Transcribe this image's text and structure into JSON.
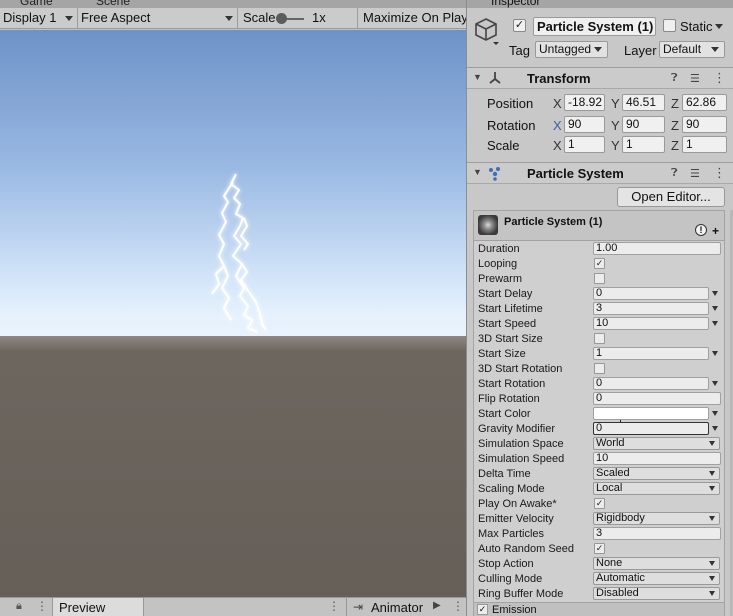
{
  "tabs": {
    "game": "Game",
    "scene": "Scene",
    "inspector": "Inspector"
  },
  "game_toolbar": {
    "display": "Display 1",
    "aspect": "Free Aspect",
    "scale_label": "Scale",
    "scale_value": "1x",
    "maximize": "Maximize On Play"
  },
  "bottom_bar": {
    "preview": "Preview",
    "animator": "Animator"
  },
  "object": {
    "name": "Particle System (1)",
    "static_label": "Static",
    "tag_label": "Tag",
    "tag_value": "Untagged",
    "layer_label": "Layer",
    "layer_value": "Default"
  },
  "transform": {
    "title": "Transform",
    "position_label": "Position",
    "rotation_label": "Rotation",
    "scale_label": "Scale",
    "axis_x": "X",
    "axis_y": "Y",
    "axis_z": "Z",
    "position": {
      "x": "-18.92",
      "y": "46.51",
      "z": "62.86"
    },
    "rotation": {
      "x": "90",
      "y": "90",
      "z": "90"
    },
    "scale": {
      "x": "1",
      "y": "1",
      "z": "1"
    }
  },
  "particle_system": {
    "title": "Particle System",
    "open_editor": "Open Editor...",
    "module_title": "Particle System (1)",
    "rows": [
      {
        "label": "Duration",
        "kind": "field",
        "value": "1.00"
      },
      {
        "label": "Looping",
        "kind": "check",
        "checked": true
      },
      {
        "label": "Prewarm",
        "kind": "check",
        "checked": false
      },
      {
        "label": "Start Delay",
        "kind": "field-arrow",
        "value": "0"
      },
      {
        "label": "Start Lifetime",
        "kind": "field-arrow",
        "value": "3"
      },
      {
        "label": "Start Speed",
        "kind": "field-arrow",
        "value": "10"
      },
      {
        "label": "3D Start Size",
        "kind": "check",
        "checked": false
      },
      {
        "label": "Start Size",
        "kind": "field-arrow",
        "value": "1"
      },
      {
        "label": "3D Start Rotation",
        "kind": "check",
        "checked": false
      },
      {
        "label": "Start Rotation",
        "kind": "field-arrow",
        "value": "0"
      },
      {
        "label": "Flip Rotation",
        "kind": "field",
        "value": "0"
      },
      {
        "label": "Start Color",
        "kind": "color-arrow",
        "value": "#ffffff"
      },
      {
        "label": "Gravity Modifier",
        "kind": "field-arrow-active",
        "value": "0"
      },
      {
        "label": "Simulation Space",
        "kind": "dropdown",
        "value": "World"
      },
      {
        "label": "Simulation Speed",
        "kind": "field",
        "value": "10"
      },
      {
        "label": "Delta Time",
        "kind": "dropdown",
        "value": "Scaled"
      },
      {
        "label": "Scaling Mode",
        "kind": "dropdown",
        "value": "Local"
      },
      {
        "label": "Play On Awake*",
        "kind": "check",
        "checked": true
      },
      {
        "label": "Emitter Velocity",
        "kind": "dropdown",
        "value": "Rigidbody"
      },
      {
        "label": "Max Particles",
        "kind": "field",
        "value": "3"
      },
      {
        "label": "Auto Random Seed",
        "kind": "check",
        "checked": true
      },
      {
        "label": "Stop Action",
        "kind": "dropdown",
        "value": "None"
      },
      {
        "label": "Culling Mode",
        "kind": "dropdown",
        "value": "Automatic"
      },
      {
        "label": "Ring Buffer Mode",
        "kind": "dropdown",
        "value": "Disabled"
      }
    ],
    "emission": {
      "label": "Emission",
      "checked": true
    }
  },
  "icons": {
    "gameobject": "cube-icon",
    "transform": "transform-axes-icon",
    "particle": "particle-icon",
    "help": "help-icon",
    "presets": "presets-icon",
    "menu": "kebab-menu-icon",
    "lock": "lock-icon",
    "maximize": "maximize-icon"
  },
  "colors": {
    "sky_top": "#6e92c8",
    "sky_horizon": "#e9f4ff",
    "ground": "#676059",
    "inspector_bg": "#c8c8c8",
    "lightning": "#ffffff"
  }
}
